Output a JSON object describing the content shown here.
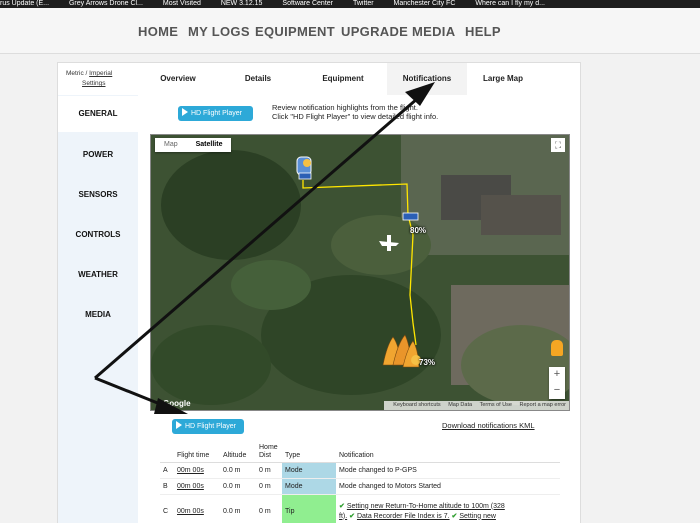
{
  "bookmarks": [
    "rus Update (E...",
    "Grey Arrows Drone Cl...",
    "Most Visited",
    "NEW 3.12.15",
    "Software Center",
    "Twitter",
    "Manchester City FC",
    "Where can I fly my d..."
  ],
  "nav": [
    "HOME",
    "MY LOGS",
    "EQUIPMENT",
    "UPGRADE",
    "MEDIA",
    "HELP"
  ],
  "units": {
    "metric": "Metric",
    "sep": "/",
    "imperial": "Imperial",
    "settings": "Settings"
  },
  "tabs": [
    "Overview",
    "Details",
    "Equipment",
    "Notifications",
    "Large Map"
  ],
  "active_tab": "Notifications",
  "sidebar": [
    "GENERAL",
    "POWER",
    "SENSORS",
    "CONTROLS",
    "WEATHER",
    "MEDIA"
  ],
  "player_button": "HD Flight Player",
  "review_line1": "Review notification highlights from the flight.",
  "review_line2": "Click \"HD Flight Player\" to view detailed flight info.",
  "map": {
    "type_map": "Map",
    "type_satellite": "Satellite",
    "battery_mid": "80%",
    "battery_end": "73%",
    "google": "Google",
    "footer": [
      "Keyboard shortcuts",
      "Map Data",
      "Terms of Use",
      "Report a map error"
    ],
    "zoom_in": "+",
    "zoom_out": "−",
    "fullscreen": "⛶"
  },
  "download_link": "Download notifications KML",
  "table": {
    "headers": [
      "",
      "Flight time",
      "Altitude",
      "Home Dist",
      "Type",
      "Notification"
    ],
    "rows": [
      {
        "id": "A",
        "time": "00m 00s",
        "alt": "0.0 m",
        "dist": "0 m",
        "type": "Mode",
        "note": "Mode changed to P-GPS"
      },
      {
        "id": "B",
        "time": "00m 00s",
        "alt": "0.0 m",
        "dist": "0 m",
        "type": "Mode",
        "note": "Mode changed to Motors Started"
      },
      {
        "id": "C",
        "time": "00m 00s",
        "alt": "0.0 m",
        "dist": "0 m",
        "type": "Tip",
        "note1": "Setting new Return-To-Home altitude to 100m (328",
        "note2a": "ft).",
        "note2b": "Data Recorder File Index is 7.",
        "note2c": "Setting new"
      }
    ]
  },
  "colors": {
    "accent": "#2da9d8",
    "mode": "#add8e6",
    "tip": "#90ee90",
    "flight_path": "#ffe600"
  }
}
